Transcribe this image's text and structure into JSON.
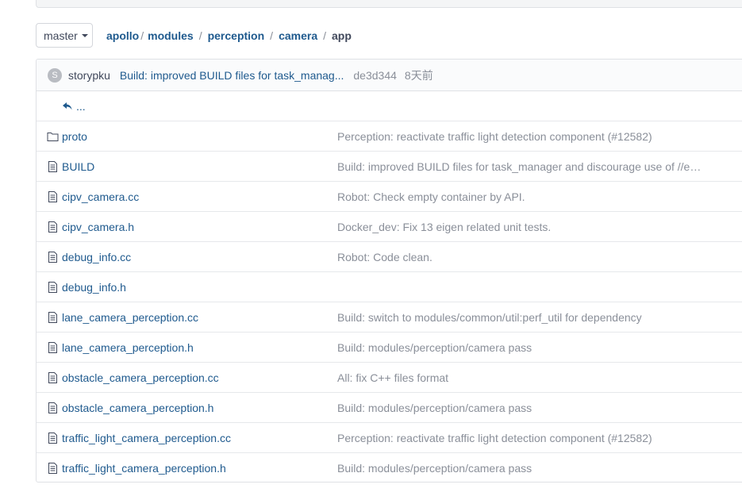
{
  "branch": {
    "label": "master"
  },
  "breadcrumb": {
    "items": [
      "apollo",
      "modules",
      "perception",
      "camera"
    ],
    "current": "app",
    "separator": "/"
  },
  "commit": {
    "avatar_letter": "S",
    "author": "storypku",
    "message": "Build: improved BUILD files for task_manag...",
    "sha": "de3d344",
    "age": "8天前"
  },
  "parent_dir": {
    "label": "..."
  },
  "files": [
    {
      "name": "proto",
      "type": "folder",
      "message": "Perception: reactivate traffic light detection component (#12582)"
    },
    {
      "name": "BUILD",
      "type": "file",
      "message": "Build: improved BUILD files for task_manager and discourage use of //e…"
    },
    {
      "name": "cipv_camera.cc",
      "type": "file",
      "message": "Robot: Check empty container by API."
    },
    {
      "name": "cipv_camera.h",
      "type": "file",
      "message": "Docker_dev: Fix 13 eigen related unit tests."
    },
    {
      "name": "debug_info.cc",
      "type": "file",
      "message": "Robot: Code clean."
    },
    {
      "name": "debug_info.h",
      "type": "file",
      "message": ""
    },
    {
      "name": "lane_camera_perception.cc",
      "type": "file",
      "message": "Build: switch to modules/common/util:perf_util for dependency"
    },
    {
      "name": "lane_camera_perception.h",
      "type": "file",
      "message": "Build: modules/perception/camera pass"
    },
    {
      "name": "obstacle_camera_perception.cc",
      "type": "file",
      "message": "All: fix C++ files format"
    },
    {
      "name": "obstacle_camera_perception.h",
      "type": "file",
      "message": "Build: modules/perception/camera pass"
    },
    {
      "name": "traffic_light_camera_perception.cc",
      "type": "file",
      "message": "Perception: reactivate traffic light detection component (#12582)"
    },
    {
      "name": "traffic_light_camera_perception.h",
      "type": "file",
      "message": "Build: modules/perception/camera pass"
    }
  ],
  "colors": {
    "link": "#1f5a8e",
    "muted": "#8a8f99",
    "text": "#40485b",
    "border": "#dfe1e5"
  }
}
